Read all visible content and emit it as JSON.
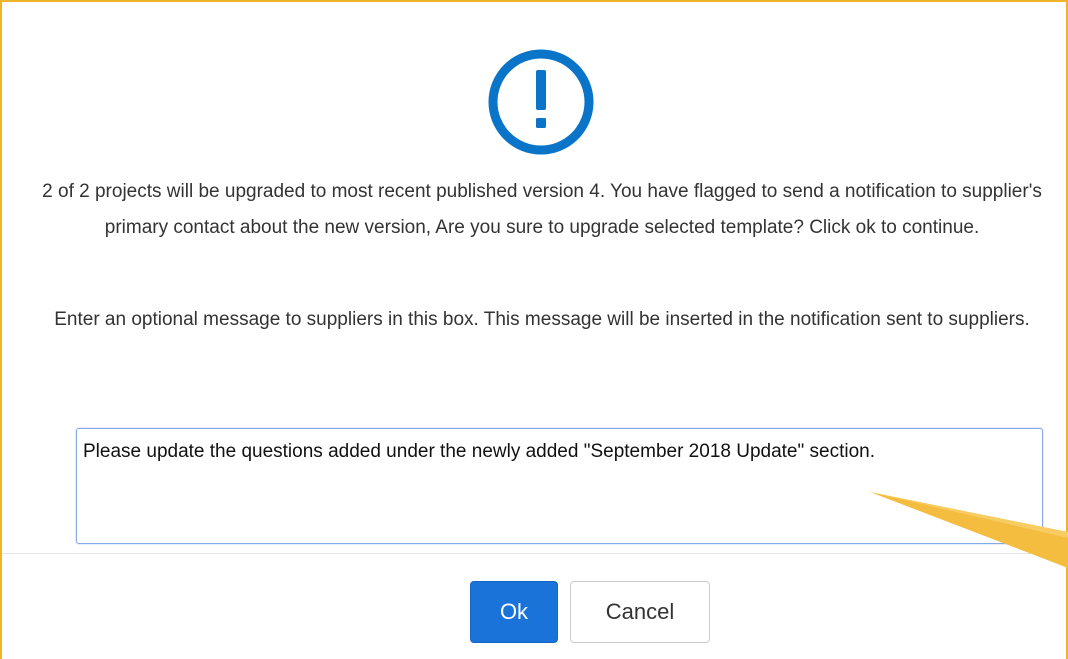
{
  "dialog": {
    "icon": "exclamation-circle-icon",
    "accent_color": "#0a74c9",
    "border_color": "#f0b429",
    "message_primary": "2 of 2 projects will be upgraded to most recent published version 4. You have flagged to send a notification to supplier's primary contact about the new version, Are you sure to upgrade selected template? Click ok to continue.",
    "message_secondary": "Enter an optional message to suppliers in this box. This message will be inserted in the notification sent to suppliers.",
    "supplier_message_value": "Please update the questions added under the newly added \"September 2018 Update\" section."
  },
  "buttons": {
    "ok_label": "Ok",
    "cancel_label": "Cancel",
    "ok_color": "#1a73d9"
  },
  "annotation": {
    "arrow_color": "#f5bd40"
  }
}
